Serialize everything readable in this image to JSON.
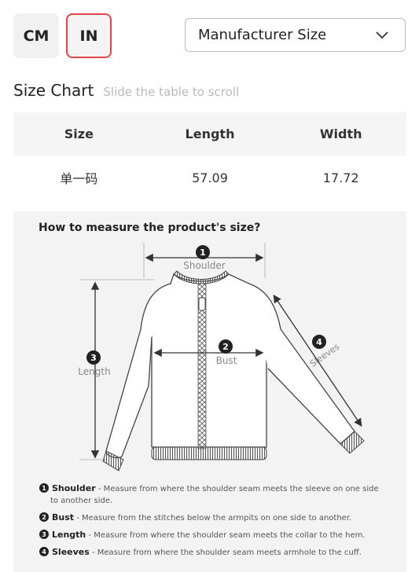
{
  "units": {
    "cm_label": "CM",
    "in_label": "IN",
    "active": "IN"
  },
  "size_select": {
    "value": "Manufacturer Size"
  },
  "size_chart": {
    "title": "Size Chart",
    "hint": "Slide the table to scroll",
    "columns": [
      "Size",
      "Length",
      "Width"
    ],
    "rows": [
      [
        "单一码",
        "57.09",
        "17.72"
      ]
    ]
  },
  "measure": {
    "title": "How to measure the product's size?",
    "diagram_labels": {
      "n1": "1",
      "shoulder": "Shoulder",
      "n2": "2",
      "bust": "Bust",
      "n3": "3",
      "length": "Length",
      "n4": "4",
      "sleeves": "Sleeves"
    },
    "legend": [
      {
        "num": "1",
        "term": "Shoulder",
        "desc": "Measure from where the shoulder seam meets the sleeve on one side to another side."
      },
      {
        "num": "2",
        "term": "Bust",
        "desc": "Measure from the stitches below the armpits on one side to another."
      },
      {
        "num": "3",
        "term": "Length",
        "desc": "Measure from where the shoulder seam meets the collar to the hem."
      },
      {
        "num": "4",
        "term": "Sleeves",
        "desc": "Measure from where the shoulder seam meets armhole to the cuff."
      }
    ]
  },
  "colors": {
    "accent_active_border": "#e0454b",
    "panel_bg": "#f3f3f3",
    "table_head_bg": "#f5f5f5"
  }
}
